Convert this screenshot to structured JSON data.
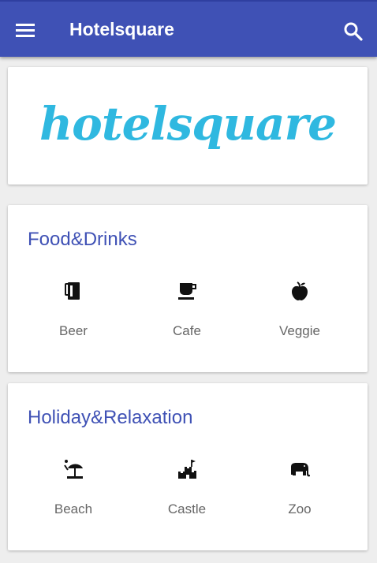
{
  "appbar": {
    "title": "Hotelsquare",
    "menu_icon": "menu-icon",
    "search_icon": "search-icon",
    "color": "#3f51b5"
  },
  "logo": {
    "text": "hotelsquare",
    "color": "#2fb8e0"
  },
  "categories": [
    {
      "title": "Food&Drinks",
      "items": [
        {
          "label": "Beer",
          "icon": "beer-mug-icon"
        },
        {
          "label": "Cafe",
          "icon": "coffee-cup-icon"
        },
        {
          "label": "Veggie",
          "icon": "apple-icon"
        }
      ]
    },
    {
      "title": "Holiday&Relaxation",
      "items": [
        {
          "label": "Beach",
          "icon": "beach-umbrella-icon"
        },
        {
          "label": "Castle",
          "icon": "castle-icon"
        },
        {
          "label": "Zoo",
          "icon": "elephant-icon"
        }
      ]
    }
  ]
}
